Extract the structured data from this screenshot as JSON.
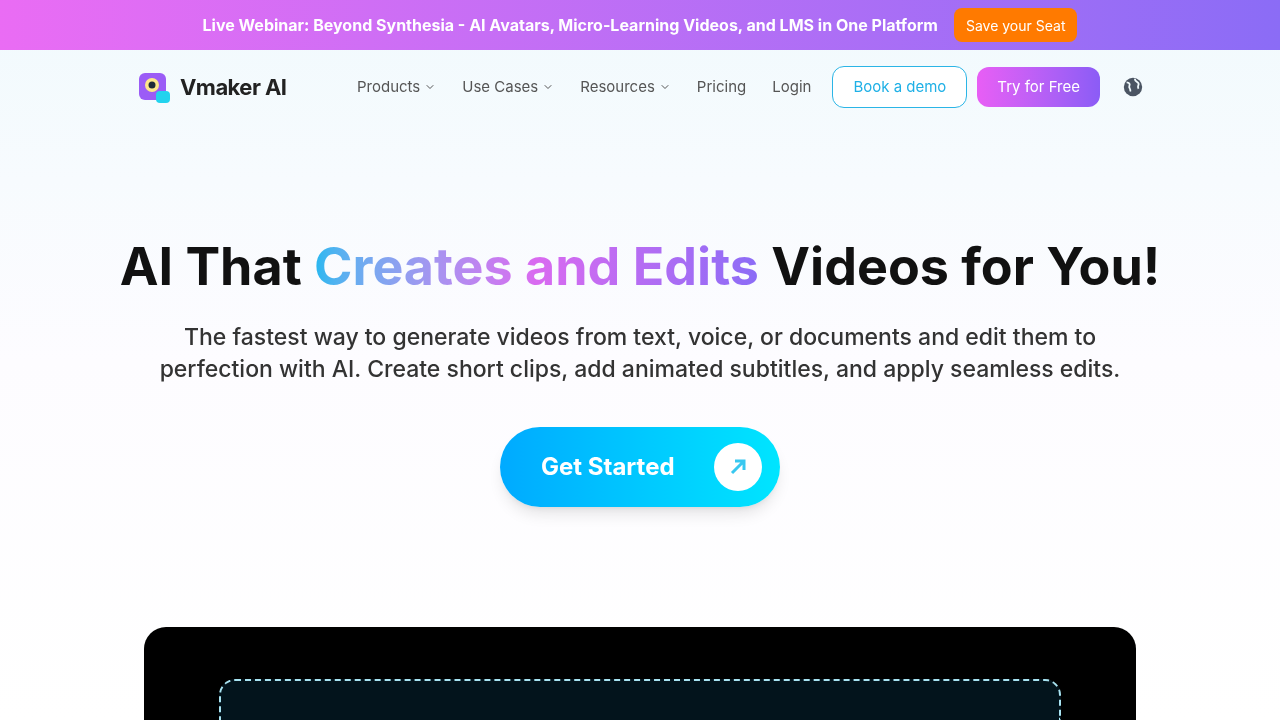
{
  "banner": {
    "text": "Live Webinar: Beyond Synthesia - AI Avatars, Micro-Learning Videos, and LMS in One Platform",
    "button": "Save your Seat"
  },
  "nav": {
    "logo": "Vmaker AI",
    "items": [
      {
        "label": "Products",
        "dropdown": true
      },
      {
        "label": "Use Cases",
        "dropdown": true
      },
      {
        "label": "Resources",
        "dropdown": true
      },
      {
        "label": "Pricing",
        "dropdown": false
      },
      {
        "label": "Login",
        "dropdown": false
      }
    ],
    "demo_button": "Book a demo",
    "try_button": "Try for Free"
  },
  "hero": {
    "title_start": "AI That ",
    "title_highlight": "Creates and Edits",
    "title_end": " Videos for You!",
    "subtitle": "The fastest way to generate videos from text, voice, or documents and edit them to perfection with AI. Create short clips, add animated subtitles, and apply seamless edits.",
    "cta": "Get Started"
  }
}
